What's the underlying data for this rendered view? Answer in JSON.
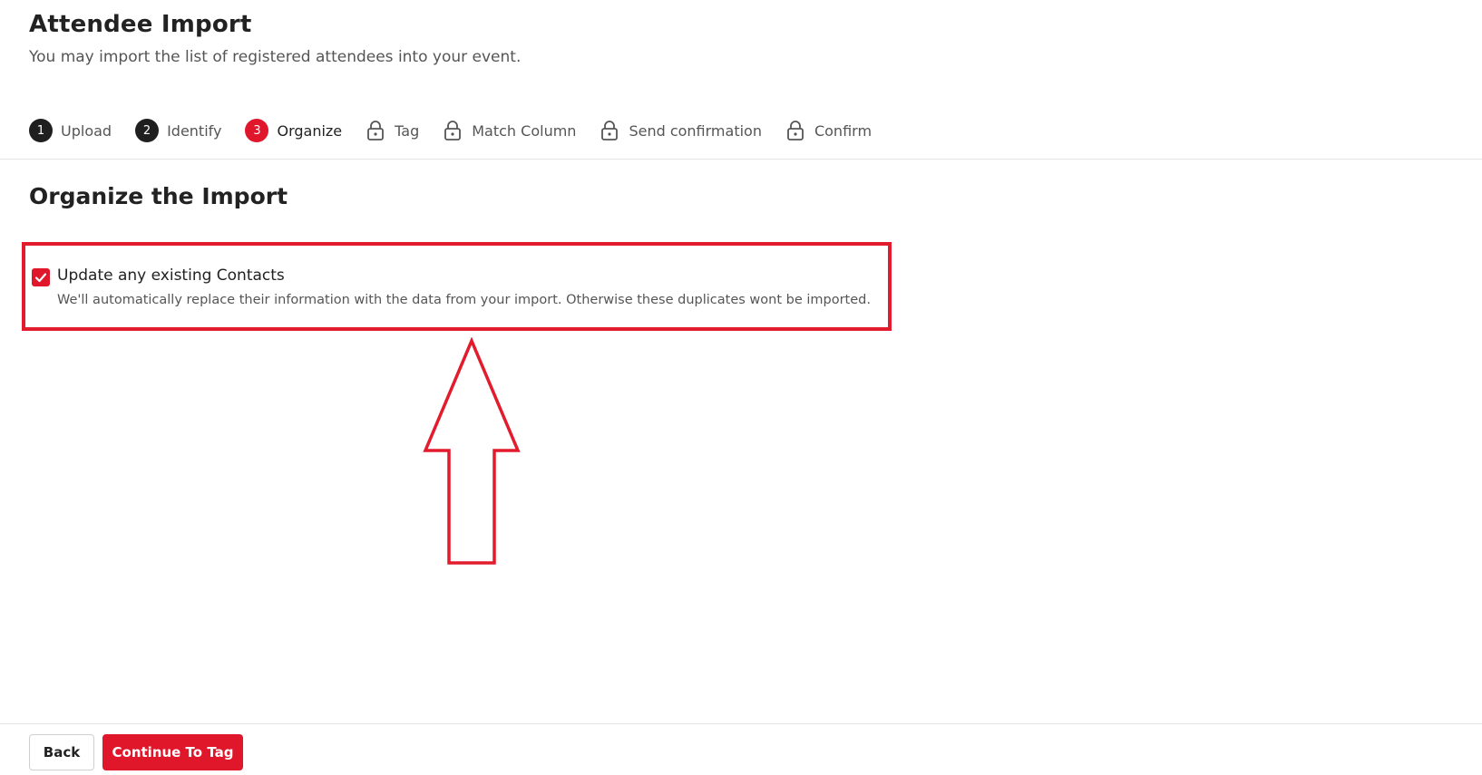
{
  "header": {
    "title": "Attendee Import",
    "subtitle": "You may import the list of registered attendees into your event."
  },
  "steps": [
    {
      "number": "1",
      "label": "Upload",
      "state": "completed"
    },
    {
      "number": "2",
      "label": "Identify",
      "state": "completed"
    },
    {
      "number": "3",
      "label": "Organize",
      "state": "active"
    },
    {
      "number": "",
      "label": "Tag",
      "state": "locked",
      "icon": "lock-icon"
    },
    {
      "number": "",
      "label": "Match Column",
      "state": "locked",
      "icon": "lock-icon"
    },
    {
      "number": "",
      "label": "Send confirmation",
      "state": "locked",
      "icon": "lock-icon"
    },
    {
      "number": "",
      "label": "Confirm",
      "state": "locked",
      "icon": "lock-icon"
    }
  ],
  "section": {
    "title": "Organize the Import"
  },
  "option": {
    "label": "Update any existing Contacts",
    "description": "We'll automatically replace their information with the data from your import. Otherwise these duplicates wont be imported.",
    "checked": true
  },
  "annotation": {
    "box_color": "#e21b2d",
    "arrow_icon": "up-arrow-icon"
  },
  "footer": {
    "back_label": "Back",
    "continue_label": "Continue To Tag"
  },
  "colors": {
    "accent": "#e0162b",
    "completed_step": "#1f1f1f",
    "text": "#222222",
    "muted_text": "#555555"
  }
}
